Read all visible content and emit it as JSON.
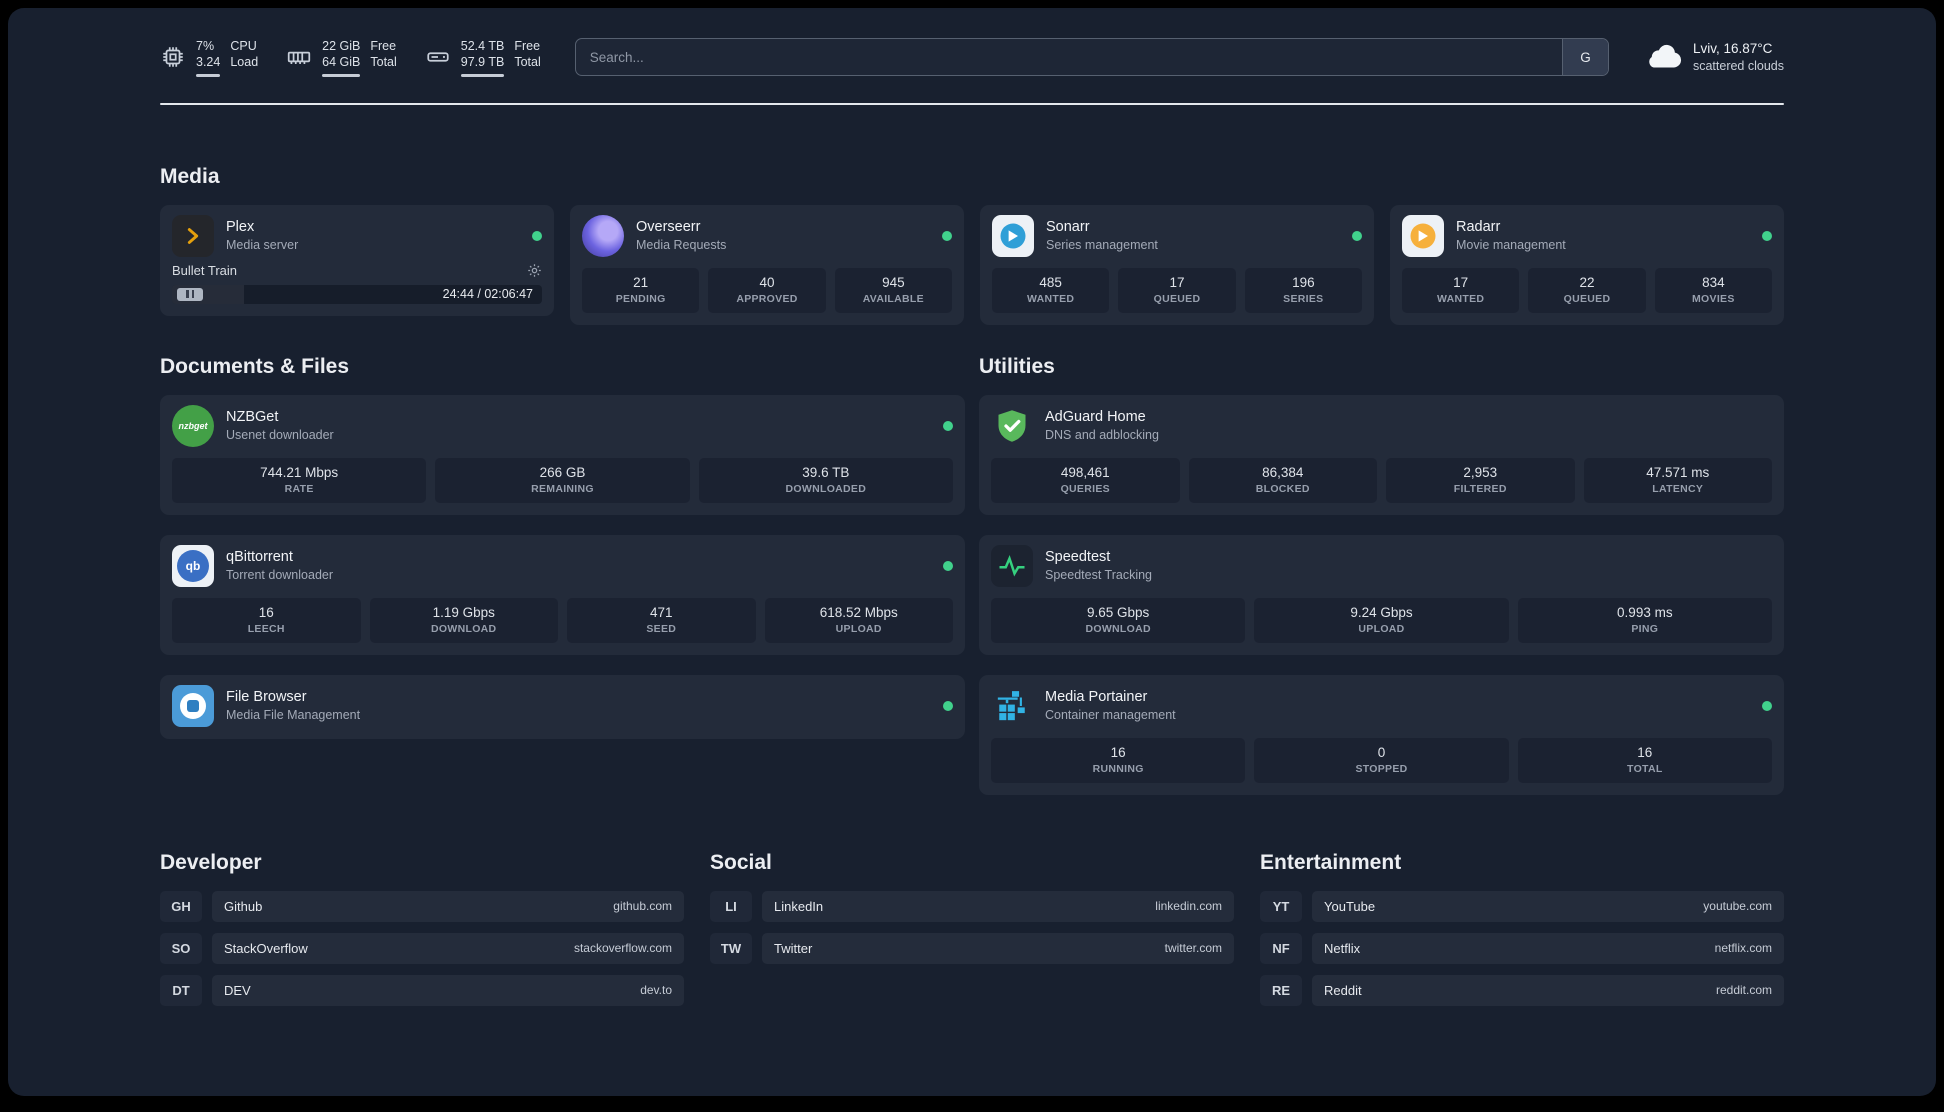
{
  "colors": {
    "page_background": "#18202f",
    "card_background": "#232b3a",
    "status_online_green": "#41d18c",
    "plex_gold": "#e5a00d"
  },
  "topbar": {
    "resources": [
      {
        "icon": "cpu-icon",
        "value_top": "7%",
        "value_bottom": "3.24",
        "label_top": "CPU",
        "label_bottom": "Load"
      },
      {
        "icon": "memory-icon",
        "value_top": "22 GiB",
        "value_bottom": "64 GiB",
        "label_top": "Free",
        "label_bottom": "Total"
      },
      {
        "icon": "disk-icon",
        "value_top": "52.4 TB",
        "value_bottom": "97.9 TB",
        "label_top": "Free",
        "label_bottom": "Total"
      }
    ],
    "search": {
      "placeholder": "Search...",
      "button_label": "G"
    },
    "weather": {
      "location": "Lviv, 16.87°C",
      "condition": "scattered clouds"
    }
  },
  "sections": {
    "media": {
      "title": "Media",
      "cards": [
        {
          "name": "Plex",
          "subtitle": "Media server",
          "online": true,
          "player": {
            "track": "Bullet Train",
            "time": "24:44 / 02:06:47",
            "progress_percent": 19.5,
            "fill_style": "width:19.5%"
          }
        },
        {
          "name": "Overseerr",
          "subtitle": "Media Requests",
          "online": true,
          "stats": [
            {
              "value": "21",
              "label": "PENDING"
            },
            {
              "value": "40",
              "label": "APPROVED"
            },
            {
              "value": "945",
              "label": "AVAILABLE"
            }
          ]
        },
        {
          "name": "Sonarr",
          "subtitle": "Series management",
          "online": true,
          "stats": [
            {
              "value": "485",
              "label": "WANTED"
            },
            {
              "value": "17",
              "label": "QUEUED"
            },
            {
              "value": "196",
              "label": "SERIES"
            }
          ]
        },
        {
          "name": "Radarr",
          "subtitle": "Movie management",
          "online": true,
          "stats": [
            {
              "value": "17",
              "label": "WANTED"
            },
            {
              "value": "22",
              "label": "QUEUED"
            },
            {
              "value": "834",
              "label": "MOVIES"
            }
          ]
        }
      ]
    },
    "documents": {
      "title": "Documents & Files",
      "cards": [
        {
          "name": "NZBGet",
          "subtitle": "Usenet downloader",
          "online": true,
          "icon_text": "nzbget",
          "stats": [
            {
              "value": "744.21 Mbps",
              "label": "RATE"
            },
            {
              "value": "266 GB",
              "label": "REMAINING"
            },
            {
              "value": "39.6 TB",
              "label": "DOWNLOADED"
            }
          ]
        },
        {
          "name": "qBittorrent",
          "subtitle": "Torrent downloader",
          "online": true,
          "icon_text": "qb",
          "stats": [
            {
              "value": "16",
              "label": "LEECH"
            },
            {
              "value": "1.19 Gbps",
              "label": "DOWNLOAD"
            },
            {
              "value": "471",
              "label": "SEED"
            },
            {
              "value": "618.52 Mbps",
              "label": "UPLOAD"
            }
          ]
        },
        {
          "name": "File Browser",
          "subtitle": "Media File Management",
          "online": true,
          "stats": []
        }
      ]
    },
    "utilities": {
      "title": "Utilities",
      "cards": [
        {
          "name": "AdGuard Home",
          "subtitle": "DNS and adblocking",
          "online": false,
          "stats": [
            {
              "value": "498,461",
              "label": "QUERIES"
            },
            {
              "value": "86,384",
              "label": "BLOCKED"
            },
            {
              "value": "2,953",
              "label": "FILTERED"
            },
            {
              "value": "47.571 ms",
              "label": "LATENCY"
            }
          ]
        },
        {
          "name": "Speedtest",
          "subtitle": "Speedtest Tracking",
          "online": false,
          "stats": [
            {
              "value": "9.65 Gbps",
              "label": "DOWNLOAD"
            },
            {
              "value": "9.24 Gbps",
              "label": "UPLOAD"
            },
            {
              "value": "0.993 ms",
              "label": "PING"
            }
          ]
        },
        {
          "name": "Media Portainer",
          "subtitle": "Container management",
          "online": true,
          "stats": [
            {
              "value": "16",
              "label": "RUNNING"
            },
            {
              "value": "0",
              "label": "STOPPED"
            },
            {
              "value": "16",
              "label": "TOTAL"
            }
          ]
        }
      ]
    }
  },
  "bookmarks": [
    {
      "title": "Developer",
      "items": [
        {
          "abbr": "GH",
          "name": "Github",
          "domain": "github.com"
        },
        {
          "abbr": "SO",
          "name": "StackOverflow",
          "domain": "stackoverflow.com"
        },
        {
          "abbr": "DT",
          "name": "DEV",
          "domain": "dev.to"
        }
      ]
    },
    {
      "title": "Social",
      "items": [
        {
          "abbr": "LI",
          "name": "LinkedIn",
          "domain": "linkedin.com"
        },
        {
          "abbr": "TW",
          "name": "Twitter",
          "domain": "twitter.com"
        }
      ]
    },
    {
      "title": "Entertainment",
      "items": [
        {
          "abbr": "YT",
          "name": "YouTube",
          "domain": "youtube.com"
        },
        {
          "abbr": "NF",
          "name": "Netflix",
          "domain": "netflix.com"
        },
        {
          "abbr": "RE",
          "name": "Reddit",
          "domain": "reddit.com"
        }
      ]
    }
  ]
}
